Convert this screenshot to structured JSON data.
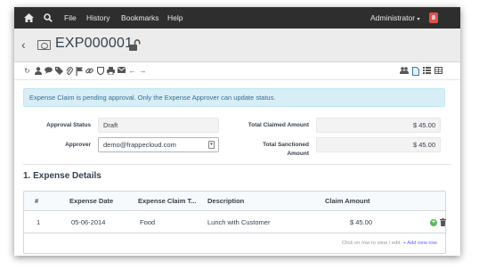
{
  "navbar": {
    "home_icon": "home-icon",
    "search_icon": "search-icon",
    "menus": [
      "File",
      "History",
      "Bookmarks",
      "Help"
    ],
    "user": "Administrator",
    "notifications": "8"
  },
  "title": {
    "doc_name": "EXP000001"
  },
  "alert": {
    "text": "Expense Claim is pending approval. Only the Expense Approver can update status."
  },
  "form": {
    "approval_status_label": "Approval Status",
    "approval_status_value": "Draft",
    "approver_label": "Approver",
    "approver_value": "demo@frappecloud.com",
    "total_claimed_label": "Total Claimed Amount",
    "total_claimed_value": "$ 45.00",
    "total_sanctioned_label_1": "Total Sanctioned",
    "total_sanctioned_label_2": "Amount",
    "total_sanctioned_value": "$ 45.00"
  },
  "section": {
    "title": "1. Expense Details"
  },
  "table": {
    "headers": [
      "#",
      "Expense Date",
      "Expense Claim T...",
      "Description",
      "Claim Amount"
    ],
    "rows": [
      {
        "idx": "1",
        "date": "05-06-2014",
        "type": "Food",
        "description": "Lunch with Customer",
        "amount": "$ 45.00"
      }
    ],
    "hint": "Click on row to view / edit.",
    "add_link": "+ Add new row."
  },
  "colors": {
    "navbar": "#2e2e2e",
    "badge": "#d9534f",
    "alert_bg": "#d9edf7",
    "alert_text": "#31708f",
    "link": "#5e64ff"
  }
}
